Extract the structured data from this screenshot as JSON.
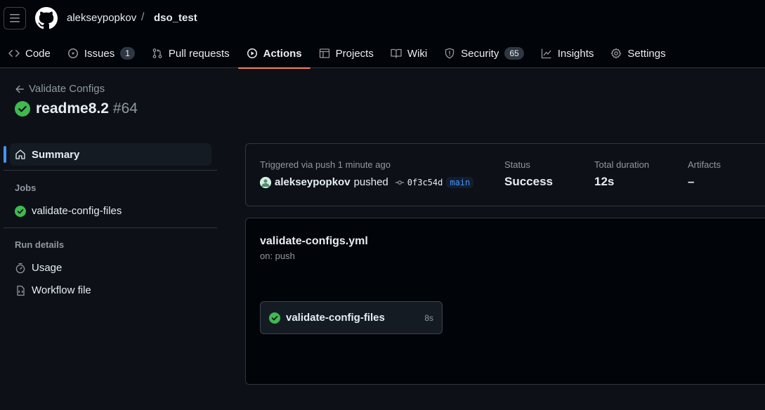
{
  "header": {
    "owner": "alekseypopkov",
    "separator": "/",
    "repo": "dso_test"
  },
  "tabs": [
    {
      "label": "Code",
      "icon": "code-icon"
    },
    {
      "label": "Issues",
      "icon": "issue-icon",
      "count": "1"
    },
    {
      "label": "Pull requests",
      "icon": "pull-request-icon"
    },
    {
      "label": "Actions",
      "icon": "play-icon",
      "active": true
    },
    {
      "label": "Projects",
      "icon": "table-icon"
    },
    {
      "label": "Wiki",
      "icon": "book-icon"
    },
    {
      "label": "Security",
      "icon": "shield-icon",
      "count": "65"
    },
    {
      "label": "Insights",
      "icon": "graph-icon"
    },
    {
      "label": "Settings",
      "icon": "gear-icon"
    }
  ],
  "run": {
    "back_label": "Validate Configs",
    "title": "readme8.2",
    "number": "#64"
  },
  "sidebar": {
    "summary_label": "Summary",
    "jobs_heading": "Jobs",
    "job_label": "validate-config-files",
    "run_details_heading": "Run details",
    "usage_label": "Usage",
    "workflow_file_label": "Workflow file"
  },
  "summary": {
    "trigger_text": "Triggered via push 1 minute ago",
    "actor": "alekseypopkov",
    "action": "pushed",
    "commit": "0f3c54d",
    "branch": "main",
    "status_label": "Status",
    "status_value": "Success",
    "duration_label": "Total duration",
    "duration_value": "12s",
    "artifacts_label": "Artifacts",
    "artifacts_value": "–"
  },
  "workflow": {
    "file_name": "validate-configs.yml",
    "trigger": "on: push",
    "job_name": "validate-config-files",
    "job_duration": "8s"
  },
  "colors": {
    "success": "#3fb950",
    "accent": "#4493f8",
    "active_tab_underline": "#f78166"
  }
}
